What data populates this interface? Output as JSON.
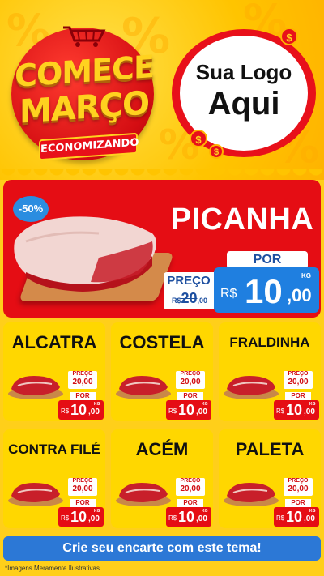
{
  "header": {
    "brand_line1": "COMECE",
    "brand_line2": "MARÇO",
    "brand_ribbon": "ECONOMIZANDO",
    "logo_line1": "Sua Logo",
    "logo_line2": "Aqui",
    "coin_symbol": "$"
  },
  "featured": {
    "discount": "-50%",
    "name": "PICANHA",
    "old_label": "PREÇO",
    "old_price_int": "20",
    "old_price_dec": ",00",
    "old_currency": "R$",
    "new_label": "POR",
    "currency": "R$",
    "price_int": "10",
    "price_dec": ",00",
    "unit": "KG"
  },
  "products": [
    {
      "name": "ALCATRA",
      "old_label": "PREÇO",
      "old_price": "20,00",
      "old_currency": "R$",
      "new_label": "POR",
      "currency": "R$",
      "price_int": "10",
      "price_dec": ",00",
      "unit": "KG"
    },
    {
      "name": "COSTELA",
      "old_label": "PREÇO",
      "old_price": "20,00",
      "old_currency": "R$",
      "new_label": "POR",
      "currency": "R$",
      "price_int": "10",
      "price_dec": ",00",
      "unit": "KG"
    },
    {
      "name": "FRALDINHA",
      "old_label": "PREÇO",
      "old_price": "20,00",
      "old_currency": "R$",
      "new_label": "POR",
      "currency": "R$",
      "price_int": "10",
      "price_dec": ",00",
      "unit": "KG"
    },
    {
      "name": "CONTRA FILÉ",
      "old_label": "PREÇO",
      "old_price": "20,00",
      "old_currency": "R$",
      "new_label": "POR",
      "currency": "R$",
      "price_int": "10",
      "price_dec": ",00",
      "unit": "KG"
    },
    {
      "name": "ACÉM",
      "old_label": "PREÇO",
      "old_price": "20,00",
      "old_currency": "R$",
      "new_label": "POR",
      "currency": "R$",
      "price_int": "10",
      "price_dec": ",00",
      "unit": "KG"
    },
    {
      "name": "PALETA",
      "old_label": "PREÇO",
      "old_price": "20,00",
      "old_currency": "R$",
      "new_label": "POR",
      "currency": "R$",
      "price_int": "10",
      "price_dec": ",00",
      "unit": "KG"
    }
  ],
  "footer": {
    "cta": "Crie seu encarte com este tema!",
    "disclaimer": "*Imagens Meramente Ilustrativas"
  },
  "colors": {
    "background": "#ffcf1a",
    "accent_red": "#e50d14",
    "accent_blue": "#1f7fe0",
    "card_yellow": "#ffd700"
  }
}
